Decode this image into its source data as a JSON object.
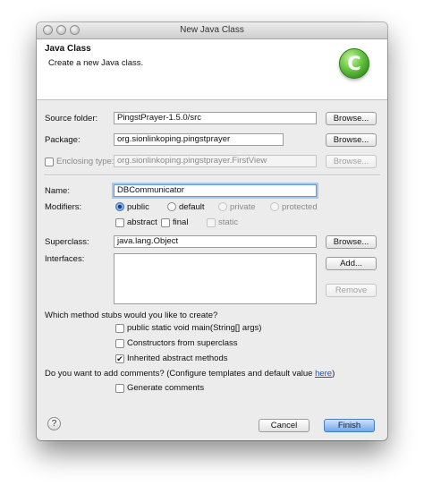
{
  "window": {
    "title": "New Java Class"
  },
  "header": {
    "title": "Java Class",
    "subtitle": "Create a new Java class.",
    "logo_icon": "java-class-wizard-icon",
    "logo_glyph": "C"
  },
  "source_folder": {
    "label": "Source folder:",
    "value": "PingstPrayer-1.5.0/src",
    "browse": "Browse..."
  },
  "package": {
    "label": "Package:",
    "value": "org.sionlinkoping.pingstprayer",
    "browse": "Browse..."
  },
  "enclosing": {
    "label": "Enclosing type:",
    "value": "org.sionlinkoping.pingstprayer.FirstView",
    "browse": "Browse...",
    "checked": false
  },
  "name": {
    "label": "Name:",
    "value": "DBCommunicator"
  },
  "modifiers": {
    "label": "Modifiers:",
    "visibility": [
      {
        "label": "public",
        "selected": true,
        "enabled": true
      },
      {
        "label": "default",
        "selected": false,
        "enabled": true
      },
      {
        "label": "private",
        "selected": false,
        "enabled": false
      },
      {
        "label": "protected",
        "selected": false,
        "enabled": false
      }
    ],
    "flags": [
      {
        "label": "abstract",
        "checked": false,
        "enabled": true
      },
      {
        "label": "final",
        "checked": false,
        "enabled": true
      },
      {
        "label": "static",
        "checked": false,
        "enabled": false
      }
    ]
  },
  "superclass": {
    "label": "Superclass:",
    "value": "java.lang.Object",
    "browse": "Browse..."
  },
  "interfaces": {
    "label": "Interfaces:",
    "add": "Add...",
    "remove": "Remove"
  },
  "stubs": {
    "question": "Which method stubs would you like to create?",
    "options": [
      {
        "label": "public static void main(String[] args)",
        "checked": false
      },
      {
        "label": "Constructors from superclass",
        "checked": false
      },
      {
        "label": "Inherited abstract methods",
        "checked": true
      }
    ]
  },
  "comments": {
    "question_prefix": "Do you want to add comments? (Configure templates and default value ",
    "link": "here",
    "question_suffix": ")",
    "option": "Generate comments",
    "checked": false
  },
  "footer": {
    "help_glyph": "?",
    "cancel": "Cancel",
    "finish": "Finish"
  },
  "colors": {
    "accent": "#6fa6ea",
    "logo": "#4caf2a",
    "link": "#1f51c4"
  }
}
